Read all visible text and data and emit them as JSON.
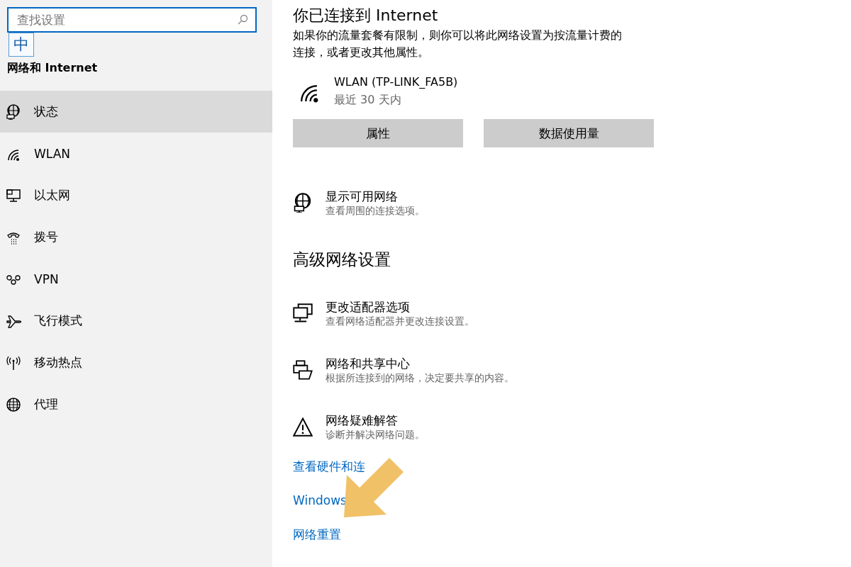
{
  "search": {
    "placeholder": "查找设置"
  },
  "ime_indicator": "中",
  "sidebar": {
    "title": "网络和 Internet",
    "items": [
      {
        "label": "状态",
        "kind": "status",
        "selected": true
      },
      {
        "label": "WLAN",
        "kind": "wlan",
        "selected": false
      },
      {
        "label": "以太网",
        "kind": "ethernet",
        "selected": false
      },
      {
        "label": "拨号",
        "kind": "dialup",
        "selected": false
      },
      {
        "label": "VPN",
        "kind": "vpn",
        "selected": false
      },
      {
        "label": "飞行模式",
        "kind": "airplane",
        "selected": false
      },
      {
        "label": "移动热点",
        "kind": "hotspot",
        "selected": false
      },
      {
        "label": "代理",
        "kind": "proxy",
        "selected": false
      }
    ]
  },
  "main": {
    "title": "你已连接到 Internet",
    "description": "如果你的流量套餐有限制，则你可以将此网络设置为按流量计费的连接，或者更改其他属性。",
    "connection": {
      "name": "WLAN (TP-LINK_FA5B)",
      "detail": "最近 30 天内"
    },
    "buttons": [
      "属性",
      "数据使用量"
    ],
    "show_networks": {
      "kind": "status",
      "title": "显示可用网络",
      "subtitle": "查看周围的连接选项。"
    },
    "advanced": {
      "heading": "高级网络设置",
      "options": [
        {
          "kind": "adapter",
          "title": "更改适配器选项",
          "subtitle": "查看网络适配器并更改连接设置。"
        },
        {
          "kind": "sharing",
          "title": "网络和共享中心",
          "subtitle": "根据所连接到的网络，决定要共享的内容。"
        },
        {
          "kind": "troubleshoot",
          "title": "网络疑难解答",
          "subtitle": "诊断并解决网络问题。"
        }
      ]
    },
    "links": [
      "查看硬件和连",
      "Windows",
      "网络重置"
    ]
  }
}
